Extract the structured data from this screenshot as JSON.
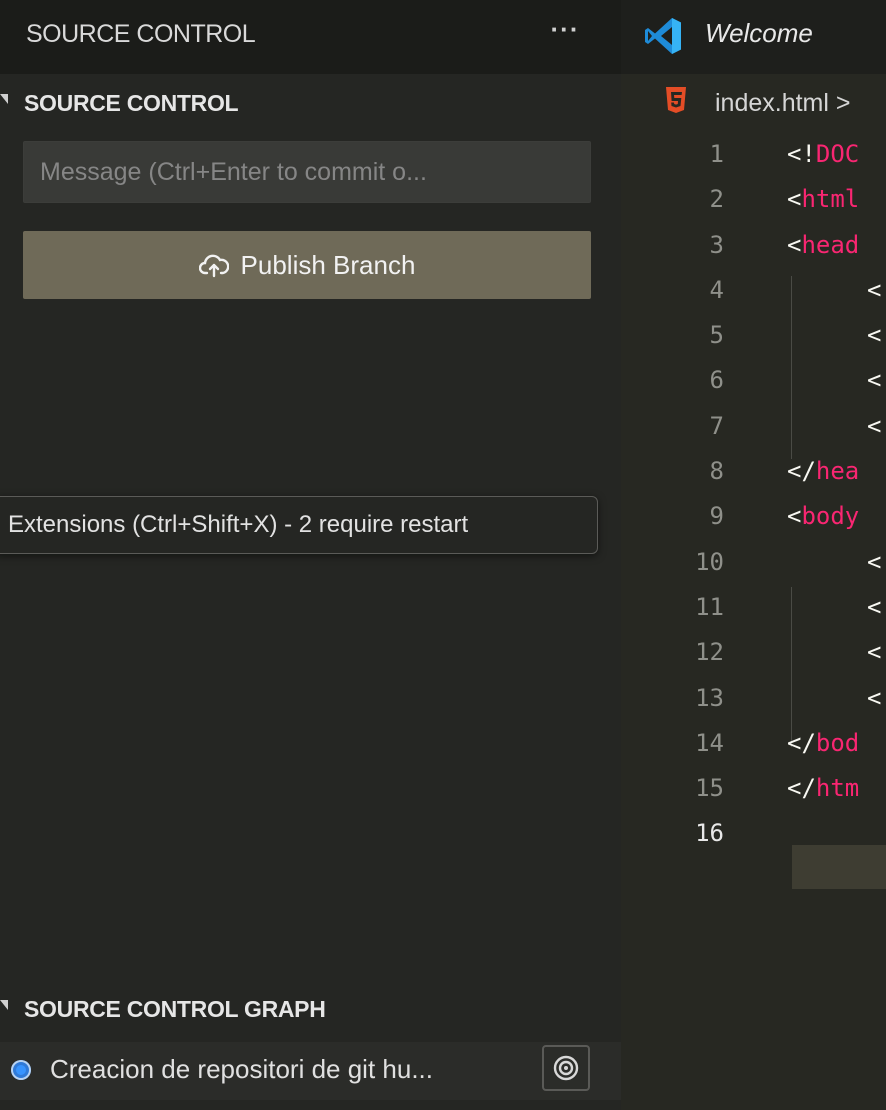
{
  "sidebar": {
    "title": "SOURCE CONTROL",
    "more_label": "···",
    "section_source_control": "SOURCE CONTROL",
    "message_placeholder": "Message (Ctrl+Enter to commit o...",
    "publish_label": "Publish Branch",
    "tooltip": "Extensions (Ctrl+Shift+X) - 2 require restart",
    "section_graph": "SOURCE CONTROL GRAPH",
    "graph_item": "Creacion de repositori de git hu...",
    "icons": {
      "more": "ellipsis-icon",
      "publish": "cloud-upload-icon",
      "graph_node": "commit-dot-icon",
      "graph_action": "target-icon"
    }
  },
  "editor": {
    "tab_label": "Welcome",
    "breadcrumb": "index.html >",
    "lines": [
      {
        "n": "1",
        "text": "<!DOC",
        "indent": false
      },
      {
        "n": "2",
        "text": "<html",
        "indent": false
      },
      {
        "n": "3",
        "text": "<head",
        "indent": false
      },
      {
        "n": "4",
        "text": "<",
        "indent": true
      },
      {
        "n": "5",
        "text": "<",
        "indent": true
      },
      {
        "n": "6",
        "text": "<",
        "indent": true
      },
      {
        "n": "7",
        "text": "<",
        "indent": true
      },
      {
        "n": "8",
        "text": "</hea",
        "indent": false
      },
      {
        "n": "9",
        "text": "<body",
        "indent": false
      },
      {
        "n": "10",
        "text": "<",
        "indent": true
      },
      {
        "n": "11",
        "text": "<",
        "indent": true
      },
      {
        "n": "12",
        "text": "<",
        "indent": true
      },
      {
        "n": "13",
        "text": "<",
        "indent": true
      },
      {
        "n": "14",
        "text": "</bod",
        "indent": false
      },
      {
        "n": "15",
        "text": "</htm",
        "indent": false
      },
      {
        "n": "16",
        "text": "",
        "indent": false,
        "active": true
      }
    ]
  },
  "colors": {
    "accent": "#3794ff",
    "publish_button": "#6f6a58",
    "tag": "#f92672",
    "html5": "#e44d26",
    "vscode_blue": "#23a9f2"
  }
}
